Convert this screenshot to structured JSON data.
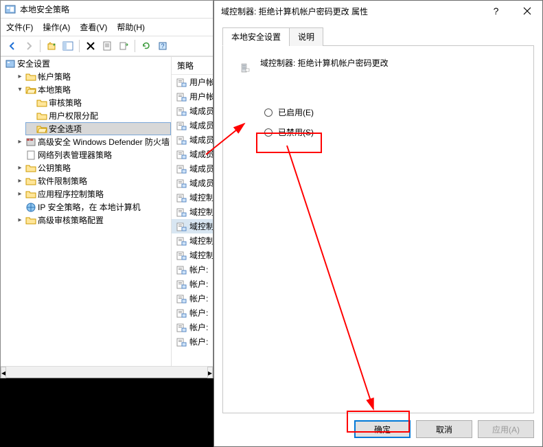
{
  "mainWindow": {
    "title": "本地安全策略",
    "menu": {
      "file": "文件(F)",
      "action": "操作(A)",
      "view": "查看(V)",
      "help": "帮助(H)"
    },
    "tree": {
      "root": "安全设置",
      "accountPolicy": "帐户策略",
      "localPolicy": "本地策略",
      "auditPolicy": "审核策略",
      "userRights": "用户权限分配",
      "securityOptions": "安全选项",
      "defenderFw": "高级安全 Windows Defender 防火墙",
      "netListMgr": "网络列表管理器策略",
      "publicKey": "公钥策略",
      "swRestrict": "软件限制策略",
      "appControl": "应用程序控制策略",
      "ipsec": "IP 安全策略，在 本地计算机",
      "advAudit": "高级审核策略配置"
    },
    "listHeader": "策略",
    "listItems": [
      "用户帐",
      "用户帐",
      "域成员",
      "域成员",
      "域成员",
      "域成员",
      "域成员",
      "域成员",
      "域控制",
      "域控制",
      "域控制",
      "域控制",
      "域控制",
      "帐户:",
      "帐户:",
      "帐户:",
      "帐户:",
      "帐户:",
      "帐户:"
    ]
  },
  "dialog": {
    "title": "域控制器: 拒绝计算机帐户密码更改 属性",
    "tabs": {
      "local": "本地安全设置",
      "explain": "说明"
    },
    "policyName": "域控制器: 拒绝计算机帐户密码更改",
    "radios": {
      "enabled": "已启用(E)",
      "disabled": "已禁用(S)"
    },
    "buttons": {
      "ok": "确定",
      "cancel": "取消",
      "apply": "应用(A)"
    }
  }
}
